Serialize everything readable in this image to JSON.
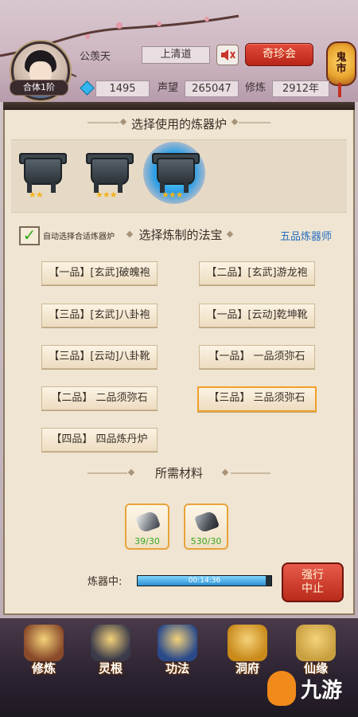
{
  "header": {
    "player_name": "公羡天",
    "level_badge": "合体1阶",
    "sect": "上清道",
    "treasure_button": "奇珍会",
    "ghost_market_top": "鬼",
    "ghost_market_bottom": "市",
    "gems": "1495",
    "reputation_label": "声望",
    "reputation": "265047",
    "cultivation_label": "修炼",
    "cultivation": "2912年"
  },
  "furnace_section": {
    "title": "选择使用的炼器炉",
    "furnaces": [
      {
        "stars": 2,
        "selected": false
      },
      {
        "stars": 3,
        "selected": false
      },
      {
        "stars": 3,
        "selected": true
      }
    ]
  },
  "craft_section": {
    "auto_select_label": "自动选择合适炼器炉",
    "auto_select_checked": true,
    "title": "选择炼制的法宝",
    "rank": "五品炼器师",
    "items": [
      {
        "label": "【一品】[玄武]破魄袍",
        "selected": false
      },
      {
        "label": "【二品】[玄武]游龙袍",
        "selected": false
      },
      {
        "label": "【三品】[玄武]八卦袍",
        "selected": false
      },
      {
        "label": "【一品】[云动]乾坤靴",
        "selected": false
      },
      {
        "label": "【三品】[云动]八卦靴",
        "selected": false
      },
      {
        "label": "【一品】 一品须弥石",
        "selected": false
      },
      {
        "label": "【二品】 二品须弥石",
        "selected": false
      },
      {
        "label": "【三品】 三品须弥石",
        "selected": true
      },
      {
        "label": "【四品】 四品炼丹炉",
        "selected": false
      }
    ]
  },
  "materials_section": {
    "title": "所需材料",
    "materials": [
      {
        "count": "39/30",
        "icon": "crystal-ore-icon"
      },
      {
        "count": "530/30",
        "icon": "iron-ore-icon"
      }
    ]
  },
  "progress": {
    "label": "炼器中:",
    "time": "00:14:36",
    "fraction": 0.96,
    "stop_line1": "强行",
    "stop_line2": "中止"
  },
  "bottom_nav": [
    {
      "label": "修炼",
      "icon": "cultivation-icon",
      "color": "#8a4a2a"
    },
    {
      "label": "灵根",
      "icon": "spirit-root-icon",
      "color": "#3a3a4a"
    },
    {
      "label": "功法",
      "icon": "technique-icon",
      "color": "#2a4a8a"
    },
    {
      "label": "洞府",
      "icon": "cave-dwelling-icon",
      "color": "#c98a1a"
    },
    {
      "label": "仙缘",
      "icon": "immortal-fate-icon",
      "color": "#c9a040"
    }
  ],
  "logo_text": "九游",
  "colors": {
    "accent_red": "#c22a1c",
    "rank_blue": "#2a6fc4",
    "material_green": "#3aa51f",
    "selected_border": "#f0a02a"
  }
}
